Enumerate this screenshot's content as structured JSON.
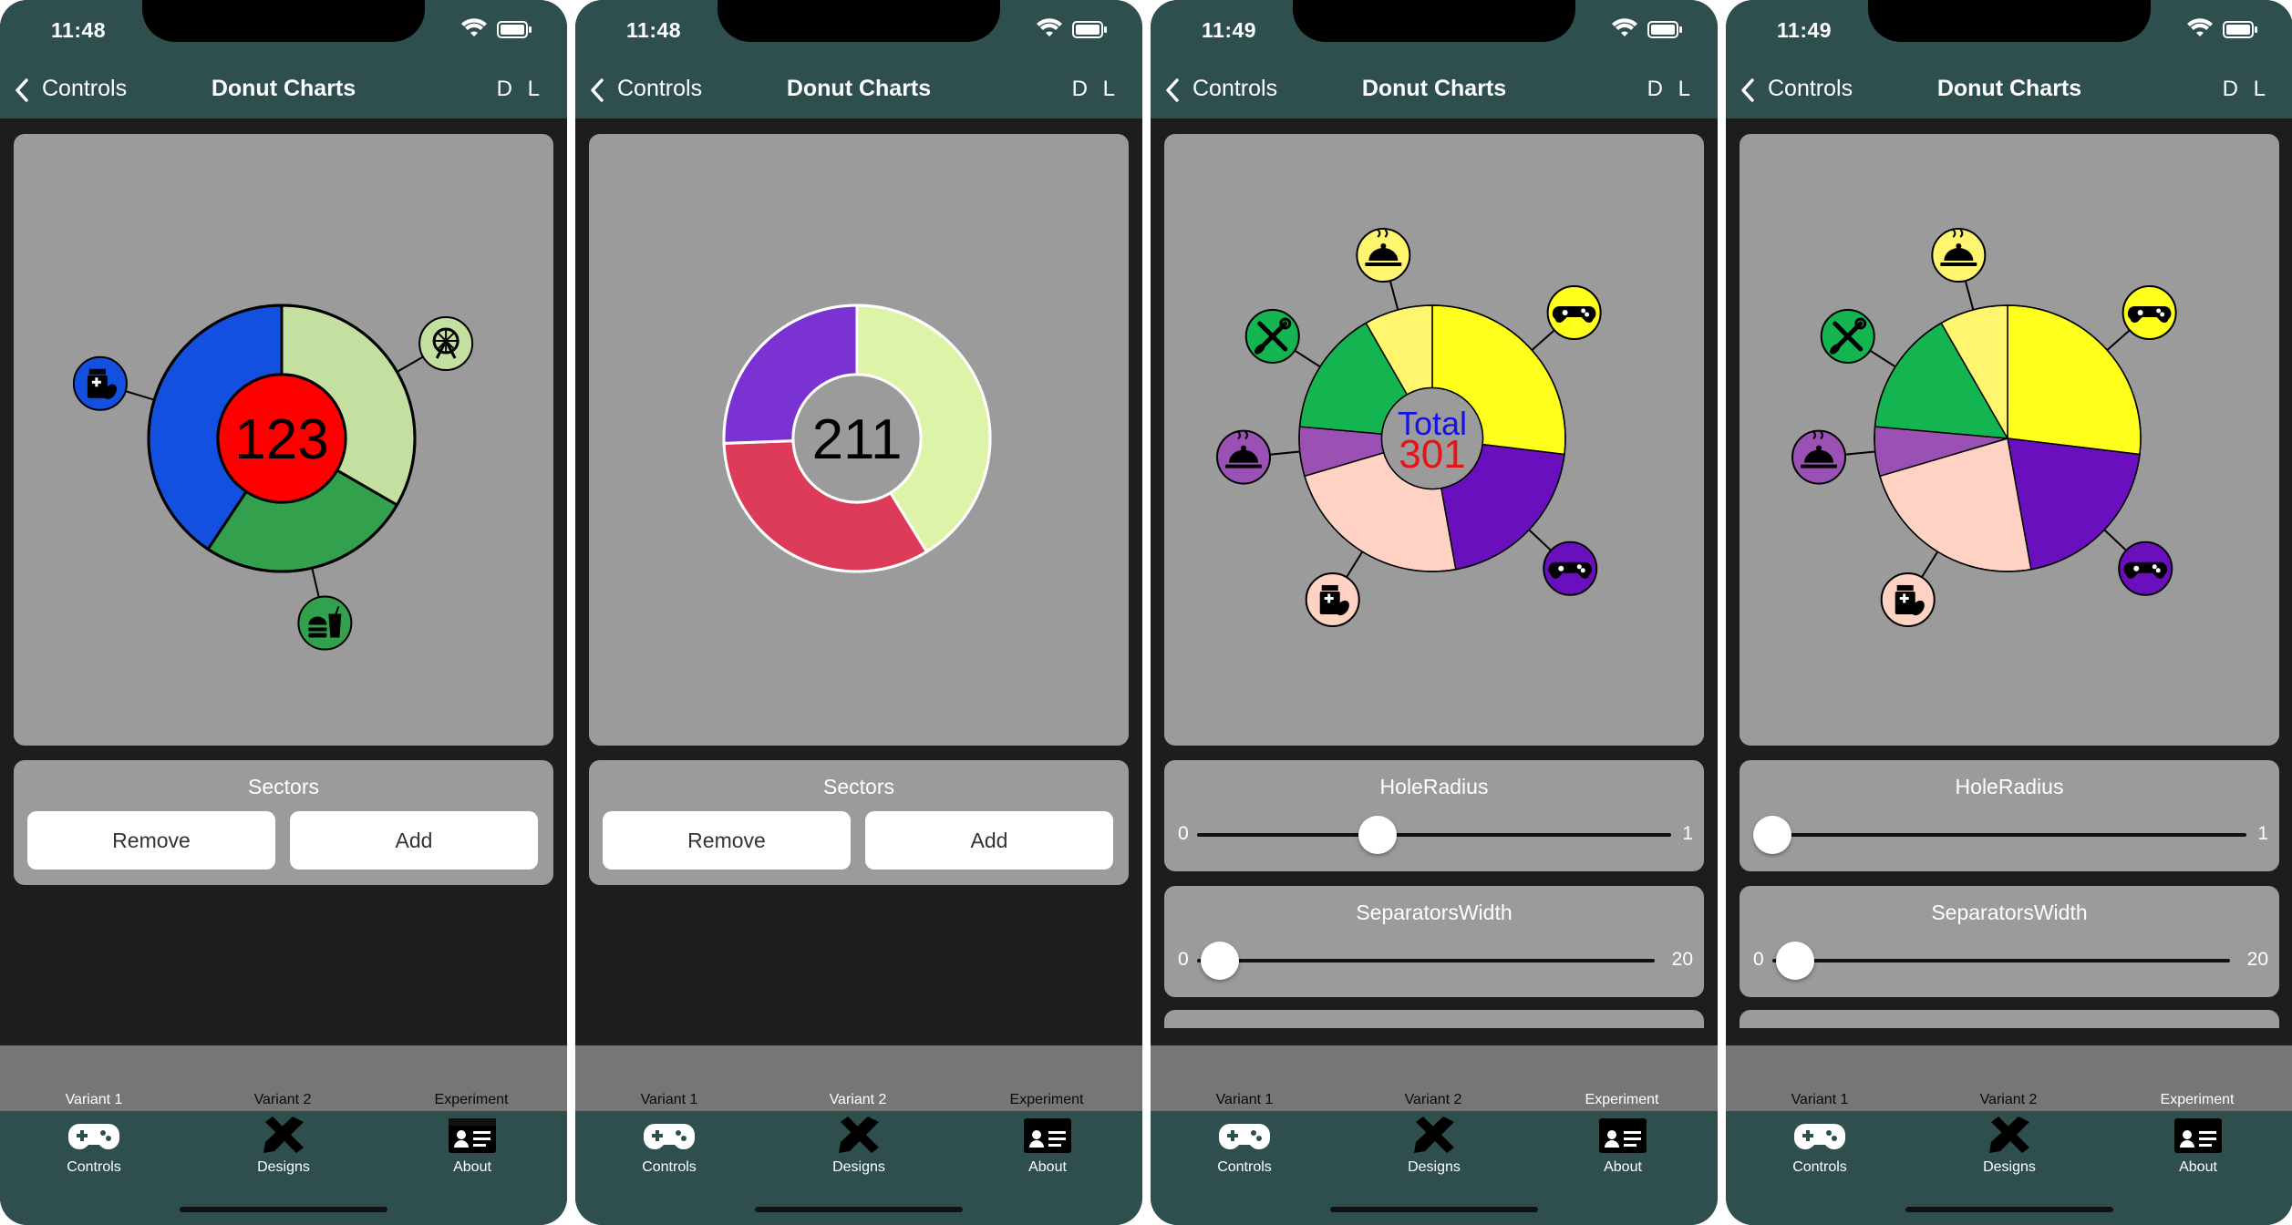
{
  "colors": {
    "bar": "#2f4f4f",
    "screen_bg": "#1d1d1d",
    "panel_bg": "#9b9b9b",
    "section_bar": "#767676"
  },
  "icon_names": [
    "wifi-icon",
    "battery-icon",
    "chevron-left-icon",
    "gamepad-icon",
    "pencil-ruler-icon",
    "id-card-icon",
    "pill-bottle-icon",
    "ferris-wheel-icon",
    "burger-drink-icon",
    "food-cloche-icon",
    "tools-icon"
  ],
  "screens": [
    {
      "time": "11:48",
      "nav": {
        "back": "Controls",
        "title": "Donut Charts",
        "d": "D",
        "l": "L"
      },
      "controls": {
        "sectors_title": "Sectors",
        "remove": "Remove",
        "add": "Add"
      },
      "sections": {
        "variant1": "Variant 1",
        "variant2": "Variant 2",
        "experiment": "Experiment",
        "active": "variant1"
      },
      "tabs": {
        "controls": "Controls",
        "designs": "Designs",
        "about": "About"
      }
    },
    {
      "time": "11:48",
      "nav": {
        "back": "Controls",
        "title": "Donut Charts",
        "d": "D",
        "l": "L"
      },
      "controls": {
        "sectors_title": "Sectors",
        "remove": "Remove",
        "add": "Add"
      },
      "sections": {
        "variant1": "Variant 1",
        "variant2": "Variant 2",
        "experiment": "Experiment",
        "active": "variant2"
      },
      "tabs": {
        "controls": "Controls",
        "designs": "Designs",
        "about": "About"
      }
    },
    {
      "time": "11:49",
      "nav": {
        "back": "Controls",
        "title": "Donut Charts",
        "d": "D",
        "l": "L"
      },
      "controls": {
        "hole_title": "HoleRadius",
        "hole_min": "0",
        "hole_max": "1",
        "hole_value": 0.38,
        "sep_title": "SeparatorsWidth",
        "sep_min": "0",
        "sep_max": "20",
        "sep_value": 1
      },
      "sections": {
        "variant1": "Variant 1",
        "variant2": "Variant 2",
        "experiment": "Experiment",
        "active": "experiment"
      },
      "tabs": {
        "controls": "Controls",
        "designs": "Designs",
        "about": "About"
      }
    },
    {
      "time": "11:49",
      "nav": {
        "back": "Controls",
        "title": "Donut Charts",
        "d": "D",
        "l": "L"
      },
      "controls": {
        "hole_title": "HoleRadius",
        "hole_min": "0",
        "hole_max": "1",
        "hole_value": 0,
        "sep_title": "SeparatorsWidth",
        "sep_min": "0",
        "sep_max": "20",
        "sep_value": 1
      },
      "sections": {
        "variant1": "Variant 1",
        "variant2": "Variant 2",
        "experiment": "Experiment",
        "active": "experiment"
      },
      "tabs": {
        "controls": "Controls",
        "designs": "Designs",
        "about": "About"
      }
    }
  ],
  "chart_data": [
    {
      "type": "pie",
      "center_label": "123",
      "hole_fraction": 0.48,
      "center_color": "#ff0000",
      "sectors": [
        {
          "value": 41,
          "color": "#c3e0a0",
          "icon": "ferris-wheel-icon"
        },
        {
          "value": 32,
          "color": "#32a04c",
          "icon": "burger-drink-icon"
        },
        {
          "value": 50,
          "color": "#1450e0",
          "icon": "pill-bottle-icon"
        }
      ]
    },
    {
      "type": "pie",
      "center_label": "211",
      "hole_fraction": 0.48,
      "center_color": "#9b9b9b",
      "sectors": [
        {
          "value": 87,
          "color": "#ddf3a8"
        },
        {
          "value": 70,
          "color": "#dc3c5a"
        },
        {
          "value": 54,
          "color": "#7a32d2"
        }
      ]
    },
    {
      "type": "pie",
      "center_title": "Total",
      "center_label": "301",
      "hole_fraction": 0.38,
      "sectors": [
        {
          "value": 81,
          "color": "#ffff1e",
          "icon": "gamepad-icon"
        },
        {
          "value": 61,
          "color": "#6a0fbe",
          "icon": "gamepad-icon"
        },
        {
          "value": 70,
          "color": "#ffd2c3",
          "icon": "pill-bottle-icon"
        },
        {
          "value": 18,
          "color": "#9b50b4",
          "icon": "food-cloche-icon"
        },
        {
          "value": 46,
          "color": "#14b450",
          "icon": "tools-icon"
        },
        {
          "value": 25,
          "color": "#fff56e",
          "icon": "food-cloche-icon"
        }
      ]
    },
    {
      "type": "pie",
      "hole_fraction": 0,
      "sectors": [
        {
          "value": 81,
          "color": "#ffff1e",
          "icon": "gamepad-icon"
        },
        {
          "value": 61,
          "color": "#6a0fbe",
          "icon": "gamepad-icon"
        },
        {
          "value": 70,
          "color": "#ffd2c3",
          "icon": "pill-bottle-icon"
        },
        {
          "value": 18,
          "color": "#9b50b4",
          "icon": "food-cloche-icon"
        },
        {
          "value": 46,
          "color": "#14b450",
          "icon": "tools-icon"
        },
        {
          "value": 25,
          "color": "#fff56e",
          "icon": "food-cloche-icon"
        }
      ]
    }
  ]
}
